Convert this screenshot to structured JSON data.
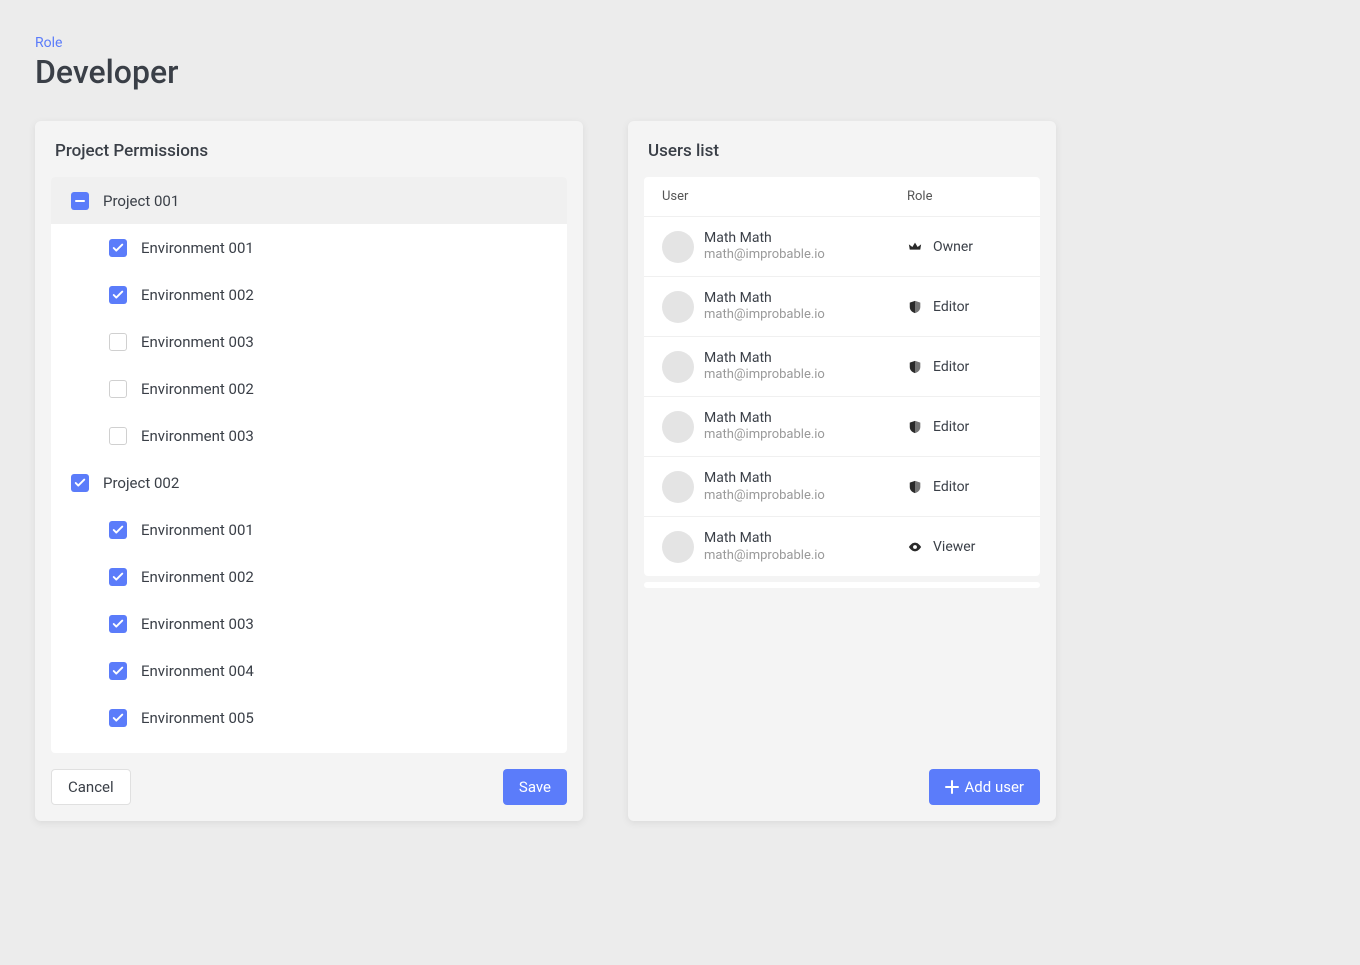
{
  "header": {
    "breadcrumb_label": "Role",
    "title": "Developer"
  },
  "permissions_panel": {
    "title": "Project Permissions",
    "cancel_label": "Cancel",
    "save_label": "Save",
    "projects": [
      {
        "label": "Project 001",
        "state": "indeterminate",
        "selected": true,
        "environments": [
          {
            "label": "Environment 001",
            "checked": true
          },
          {
            "label": "Environment 002",
            "checked": true
          },
          {
            "label": "Environment 003",
            "checked": false
          },
          {
            "label": "Environment 002",
            "checked": false
          },
          {
            "label": "Environment 003",
            "checked": false
          }
        ]
      },
      {
        "label": "Project 002",
        "state": "checked",
        "selected": false,
        "environments": [
          {
            "label": "Environment 001",
            "checked": true
          },
          {
            "label": "Environment 002",
            "checked": true
          },
          {
            "label": "Environment 003",
            "checked": true
          },
          {
            "label": "Environment 004",
            "checked": true
          },
          {
            "label": "Environment 005",
            "checked": true
          }
        ]
      }
    ]
  },
  "users_panel": {
    "title": "Users list",
    "col_user": "User",
    "col_role": "Role",
    "add_user_label": "Add user",
    "users": [
      {
        "name": "Math Math",
        "email": "math@improbable.io",
        "role": "Owner",
        "role_icon": "crown"
      },
      {
        "name": "Math Math",
        "email": "math@improbable.io",
        "role": "Editor",
        "role_icon": "shield"
      },
      {
        "name": "Math Math",
        "email": "math@improbable.io",
        "role": "Editor",
        "role_icon": "shield"
      },
      {
        "name": "Math Math",
        "email": "math@improbable.io",
        "role": "Editor",
        "role_icon": "shield"
      },
      {
        "name": "Math Math",
        "email": "math@improbable.io",
        "role": "Editor",
        "role_icon": "shield"
      },
      {
        "name": "Math Math",
        "email": "math@improbable.io",
        "role": "Viewer",
        "role_icon": "eye"
      }
    ]
  }
}
